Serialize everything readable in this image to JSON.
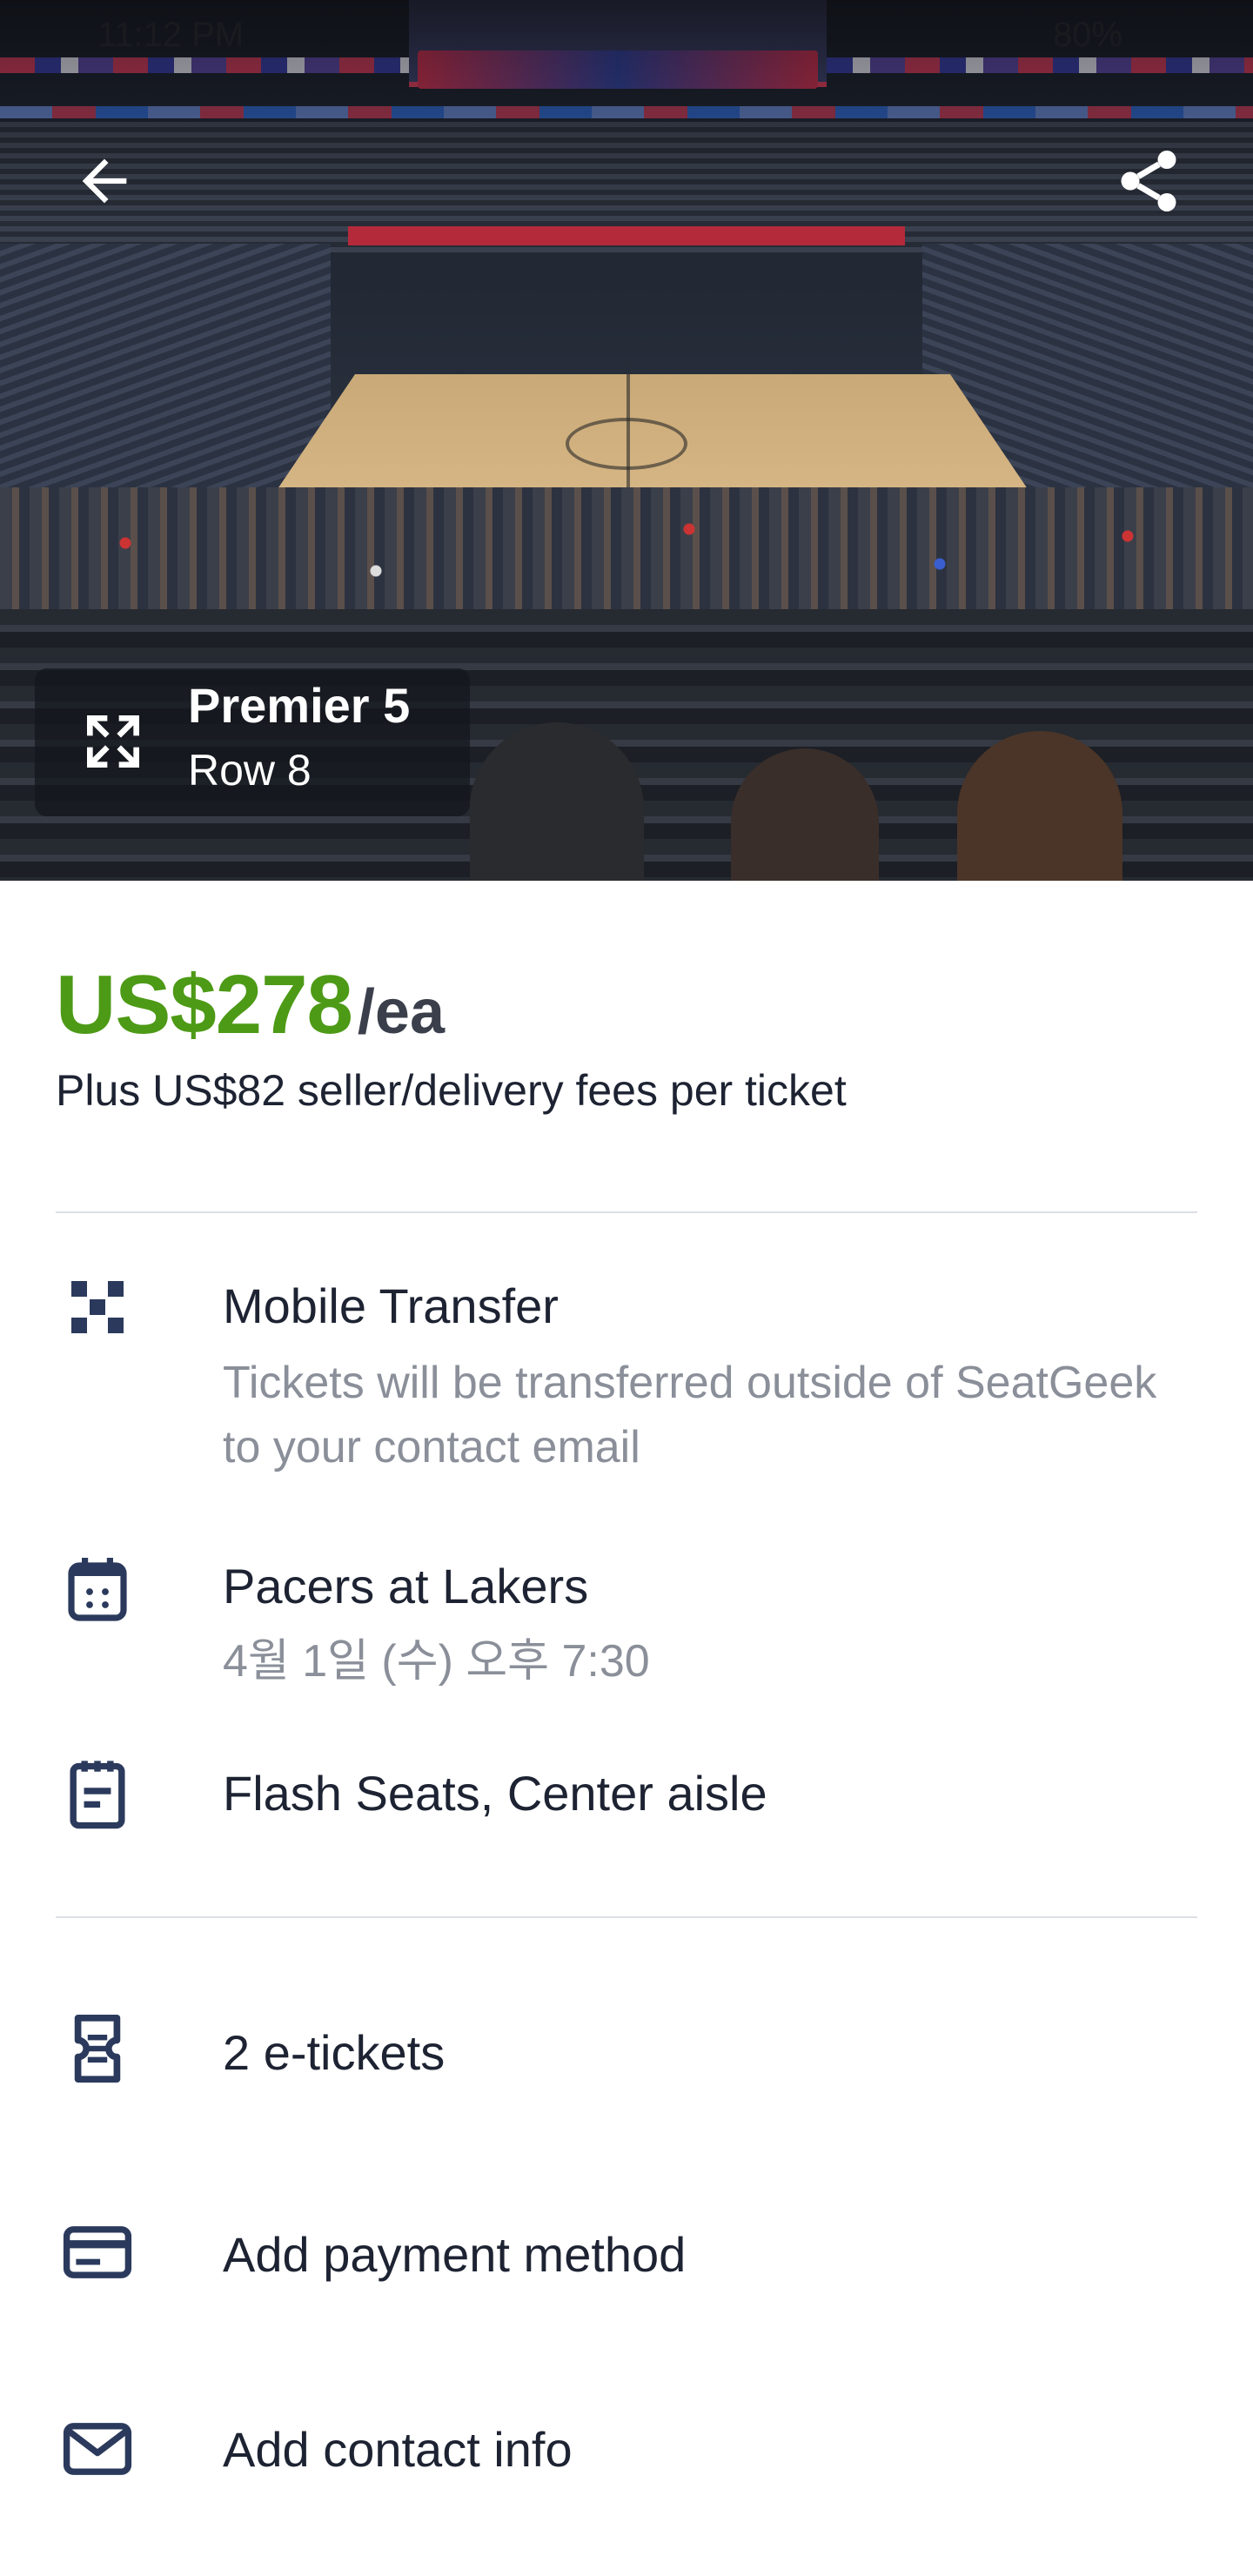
{
  "status_bar": {
    "time": "11:12 PM",
    "battery": "80%"
  },
  "hero": {
    "section_name": "Premier 5",
    "row": "Row 8"
  },
  "price": {
    "amount": "US$278",
    "unit": "/ea",
    "fees": "Plus US$82 seller/delivery fees per ticket",
    "color": "#4d9a16"
  },
  "details": {
    "delivery_title": "Mobile Transfer",
    "delivery_desc": "Tickets will be transferred outside of SeatGeek to your contact email",
    "event_title": "Pacers at Lakers",
    "event_date": "4월 1일 (수) 오후 7:30",
    "notes": "Flash Seats, Center aisle"
  },
  "checkout": {
    "tickets": "2 e-tickets",
    "payment": "Add payment method",
    "contact": "Add contact info"
  },
  "icons": {
    "back": "arrow-left-icon",
    "share": "share-icon",
    "expand": "expand-icon",
    "delivery": "qr-code-icon",
    "event": "calendar-icon",
    "notes": "note-icon",
    "tickets": "ticket-icon",
    "payment": "credit-card-icon",
    "contact": "mail-icon"
  },
  "colors": {
    "icon": "#2b3a5c",
    "accent_green": "#4d9a16"
  }
}
